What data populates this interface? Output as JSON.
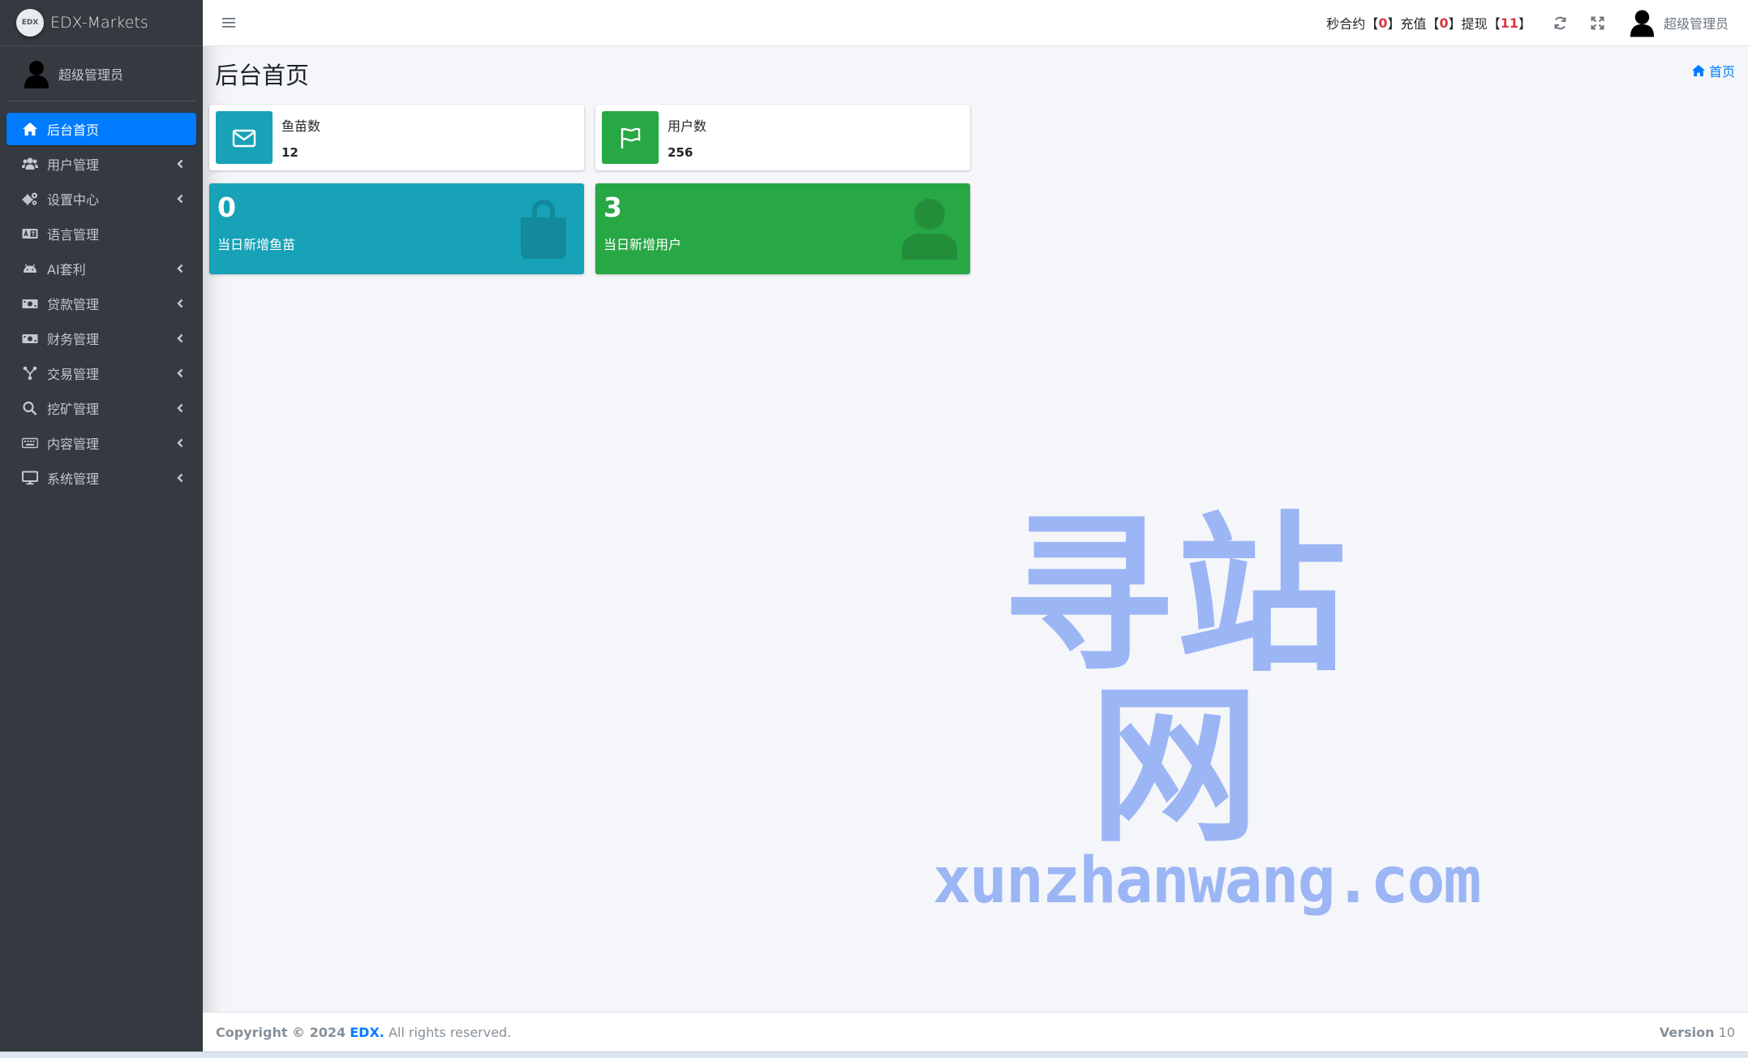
{
  "brand": {
    "logo_text": "EDX",
    "name": "EDX-Markets"
  },
  "user": {
    "name": "超级管理员"
  },
  "sidebar": {
    "items": [
      {
        "label": "后台首页",
        "icon": "home-icon",
        "active": true,
        "has_children": false
      },
      {
        "label": "用户管理",
        "icon": "users-icon",
        "active": false,
        "has_children": true
      },
      {
        "label": "设置中心",
        "icon": "cogs-icon",
        "active": false,
        "has_children": true
      },
      {
        "label": "语言管理",
        "icon": "language-icon",
        "active": false,
        "has_children": false
      },
      {
        "label": "AI套利",
        "icon": "android-icon",
        "active": false,
        "has_children": true
      },
      {
        "label": "贷款管理",
        "icon": "money-icon",
        "active": false,
        "has_children": true
      },
      {
        "label": "财务管理",
        "icon": "money-icon",
        "active": false,
        "has_children": true
      },
      {
        "label": "交易管理",
        "icon": "network-icon",
        "active": false,
        "has_children": true
      },
      {
        "label": "挖矿管理",
        "icon": "search-icon",
        "active": false,
        "has_children": true
      },
      {
        "label": "内容管理",
        "icon": "keyboard-icon",
        "active": false,
        "has_children": true
      },
      {
        "label": "系统管理",
        "icon": "desktop-icon",
        "active": false,
        "has_children": true
      }
    ]
  },
  "navbar": {
    "stats": [
      {
        "label": "秒合约",
        "value": "0"
      },
      {
        "label": "充值",
        "value": "0"
      },
      {
        "label": "提现",
        "value": "11"
      }
    ],
    "bracket_open": "【",
    "bracket_close": "】"
  },
  "page": {
    "title": "后台首页",
    "breadcrumb": "首页"
  },
  "info_boxes": [
    {
      "label": "鱼苗数",
      "value": "12",
      "color": "#17a2b8",
      "icon": "envelope-icon"
    },
    {
      "label": "用户数",
      "value": "256",
      "color": "#28a745",
      "icon": "flag-icon"
    }
  ],
  "small_boxes": [
    {
      "value": "0",
      "label": "当日新增鱼苗",
      "color": "#17a2b8",
      "icon": "shopping-bag-icon"
    },
    {
      "value": "3",
      "label": "当日新增用户",
      "color": "#28a745",
      "icon": "user-icon"
    }
  ],
  "watermark": {
    "cn": "寻站网",
    "en": "xunzhanwang.com"
  },
  "footer": {
    "copyright_prefix": "Copyright © 2024",
    "brand": "EDX.",
    "rights": "All rights reserved.",
    "version_label": "Version",
    "version_value": "10"
  }
}
